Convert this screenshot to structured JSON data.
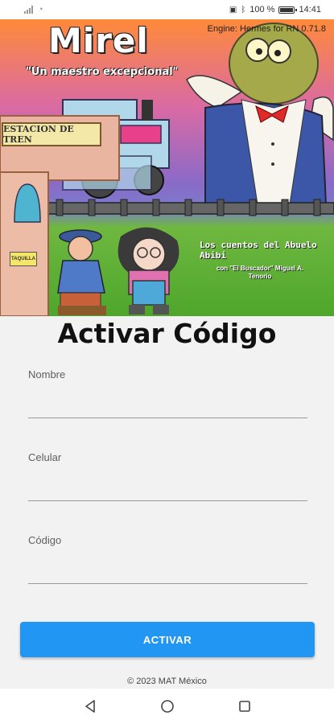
{
  "status_bar": {
    "battery_text": "100 %",
    "time": "14:41"
  },
  "banner": {
    "title": "Mirel",
    "subtitle": "\"Un maestro excepcional\"",
    "engine_text": "Engine: Hermes for RN 0.71.8",
    "station_sign": "ESTACION DE TREN",
    "ticket_sign": "TAQUILLA",
    "series_title": "Los cuentos del Abuelo Abibi",
    "credits": "con \"El Buscador\" Miguel A. Tenorio"
  },
  "form": {
    "title": "Activar Código",
    "name_label": "Nombre",
    "name_value": "",
    "phone_label": "Celular",
    "phone_value": "",
    "code_label": "Código",
    "code_value": "",
    "submit_label": "ACTIVAR"
  },
  "footer": {
    "copyright": "© 2023 MAT México"
  },
  "nav": {
    "back": "back-icon",
    "home": "home-icon",
    "recents": "recents-icon"
  },
  "colors": {
    "accent": "#2196f3",
    "background": "#f2f2f2"
  }
}
